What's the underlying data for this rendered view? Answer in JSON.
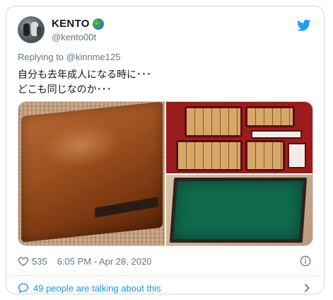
{
  "author": {
    "display_name": "KENTO",
    "handle": "@kento00t",
    "badge": "globe-emoji"
  },
  "reply": {
    "prefix": "Replying to",
    "to": "@kinnme125"
  },
  "tweet": {
    "text": "自分も去年成人になる時に･･･\nどこも同じなのか･･･"
  },
  "media": {
    "count": 3
  },
  "meta": {
    "likes": "535",
    "timestamp": "6:05 PM - Apr 28, 2020"
  },
  "footer": {
    "talking": "49 people are talking about this"
  },
  "colors": {
    "twitter_blue": "#1da1f2",
    "link_blue": "#1b95e0",
    "muted": "#657786",
    "border": "#cfd9de"
  }
}
